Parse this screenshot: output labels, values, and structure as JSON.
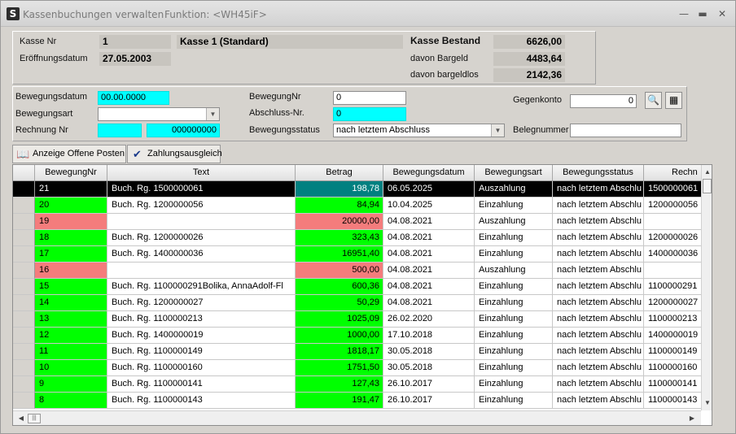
{
  "window": {
    "title": "Kassenbuchungen verwalten",
    "function": "Funktion: <WH45iF>",
    "icon_letter": "S"
  },
  "kasse": {
    "nr_label": "Kasse Nr",
    "nr": "1",
    "name": "Kasse 1 (Standard)",
    "date_label": "Eröffnungsdatum",
    "date": "27.05.2003",
    "bestand_label": "Kasse Bestand",
    "bestand": "6626,00",
    "bargeld_label": "davon Bargeld",
    "bargeld": "4483,64",
    "bargeldlos_label": "davon bargeldlos",
    "bargeldlos": "2142,36"
  },
  "filter": {
    "bewegungsdatum_label": "Bewegungsdatum",
    "bewegungsdatum": "00.00.0000",
    "bewegungsart_label": "Bewegungsart",
    "bewegungsart": "",
    "rechnung_label": "Rechnung Nr",
    "rechnung_a": "",
    "rechnung_b": "000000000",
    "bewegungnr_label": "BewegungNr",
    "bewegungnr": "0",
    "abschluss_label": "Abschluss-Nr.",
    "abschluss": "0",
    "status_label": "Bewegungsstatus",
    "status": "nach letztem Abschluss",
    "gegenkonto_label": "Gegenkonto",
    "gegenkonto": "0",
    "belegnummer_label": "Belegnummer",
    "belegnummer": ""
  },
  "toolbar": {
    "offene_posten": "Anzeige Offene Posten",
    "zahlungsausgleich": "Zahlungsausgleich"
  },
  "colors": {
    "green": "#00ff00",
    "pink": "#f47c7c",
    "cyan": "#00ffff",
    "selected": "#000000",
    "selected_amount": "#008080"
  },
  "grid": {
    "columns": [
      "BewegungNr",
      "Text",
      "Betrag",
      "Bewegungsdatum",
      "Bewegungsart",
      "Bewegungsstatus",
      "Rechn"
    ],
    "rows": [
      {
        "nr": "21",
        "text": "Buch. Rg. 1500000061",
        "betrag": "198,78",
        "datum": "06.05.2025",
        "art": "Auszahlung",
        "status": "nach letztem Abschlu",
        "rechnung": "1500000061",
        "color": "selected"
      },
      {
        "nr": "20",
        "text": "Buch. Rg. 1200000056",
        "betrag": "84,94",
        "datum": "10.04.2025",
        "art": "Einzahlung",
        "status": "nach letztem Abschlu",
        "rechnung": "1200000056",
        "color": "green"
      },
      {
        "nr": "19",
        "text": "",
        "betrag": "20000,00",
        "datum": "04.08.2021",
        "art": "Auszahlung",
        "status": "nach letztem Abschlu",
        "rechnung": "",
        "color": "pink"
      },
      {
        "nr": "18",
        "text": "Buch. Rg. 1200000026",
        "betrag": "323,43",
        "datum": "04.08.2021",
        "art": "Einzahlung",
        "status": "nach letztem Abschlu",
        "rechnung": "1200000026",
        "color": "green"
      },
      {
        "nr": "17",
        "text": "Buch. Rg. 1400000036",
        "betrag": "16951,40",
        "datum": "04.08.2021",
        "art": "Einzahlung",
        "status": "nach letztem Abschlu",
        "rechnung": "1400000036",
        "color": "green"
      },
      {
        "nr": "16",
        "text": "",
        "betrag": "500,00",
        "datum": "04.08.2021",
        "art": "Auszahlung",
        "status": "nach letztem Abschlu",
        "rechnung": "",
        "color": "pink"
      },
      {
        "nr": "15",
        "text": "Buch. Rg. 1100000291Bolika, AnnaAdolf-Fl",
        "betrag": "600,36",
        "datum": "04.08.2021",
        "art": "Einzahlung",
        "status": "nach letztem Abschlu",
        "rechnung": "1100000291",
        "color": "green"
      },
      {
        "nr": "14",
        "text": "Buch. Rg. 1200000027",
        "betrag": "50,29",
        "datum": "04.08.2021",
        "art": "Einzahlung",
        "status": "nach letztem Abschlu",
        "rechnung": "1200000027",
        "color": "green"
      },
      {
        "nr": "13",
        "text": "Buch. Rg. 1100000213",
        "betrag": "1025,09",
        "datum": "26.02.2020",
        "art": "Einzahlung",
        "status": "nach letztem Abschlu",
        "rechnung": "1100000213",
        "color": "green"
      },
      {
        "nr": "12",
        "text": "Buch. Rg. 1400000019",
        "betrag": "1000,00",
        "datum": "17.10.2018",
        "art": "Einzahlung",
        "status": "nach letztem Abschlu",
        "rechnung": "1400000019",
        "color": "green"
      },
      {
        "nr": "11",
        "text": "Buch. Rg. 1100000149",
        "betrag": "1818,17",
        "datum": "30.05.2018",
        "art": "Einzahlung",
        "status": "nach letztem Abschlu",
        "rechnung": "1100000149",
        "color": "green"
      },
      {
        "nr": "10",
        "text": "Buch. Rg. 1100000160",
        "betrag": "1751,50",
        "datum": "30.05.2018",
        "art": "Einzahlung",
        "status": "nach letztem Abschlu",
        "rechnung": "1100000160",
        "color": "green"
      },
      {
        "nr": "9",
        "text": "Buch. Rg. 1100000141",
        "betrag": "127,43",
        "datum": "26.10.2017",
        "art": "Einzahlung",
        "status": "nach letztem Abschlu",
        "rechnung": "1100000141",
        "color": "green"
      },
      {
        "nr": "8",
        "text": "Buch. Rg. 1100000143",
        "betrag": "191,47",
        "datum": "26.10.2017",
        "art": "Einzahlung",
        "status": "nach letztem Abschlu",
        "rechnung": "1100000143",
        "color": "green"
      }
    ]
  }
}
